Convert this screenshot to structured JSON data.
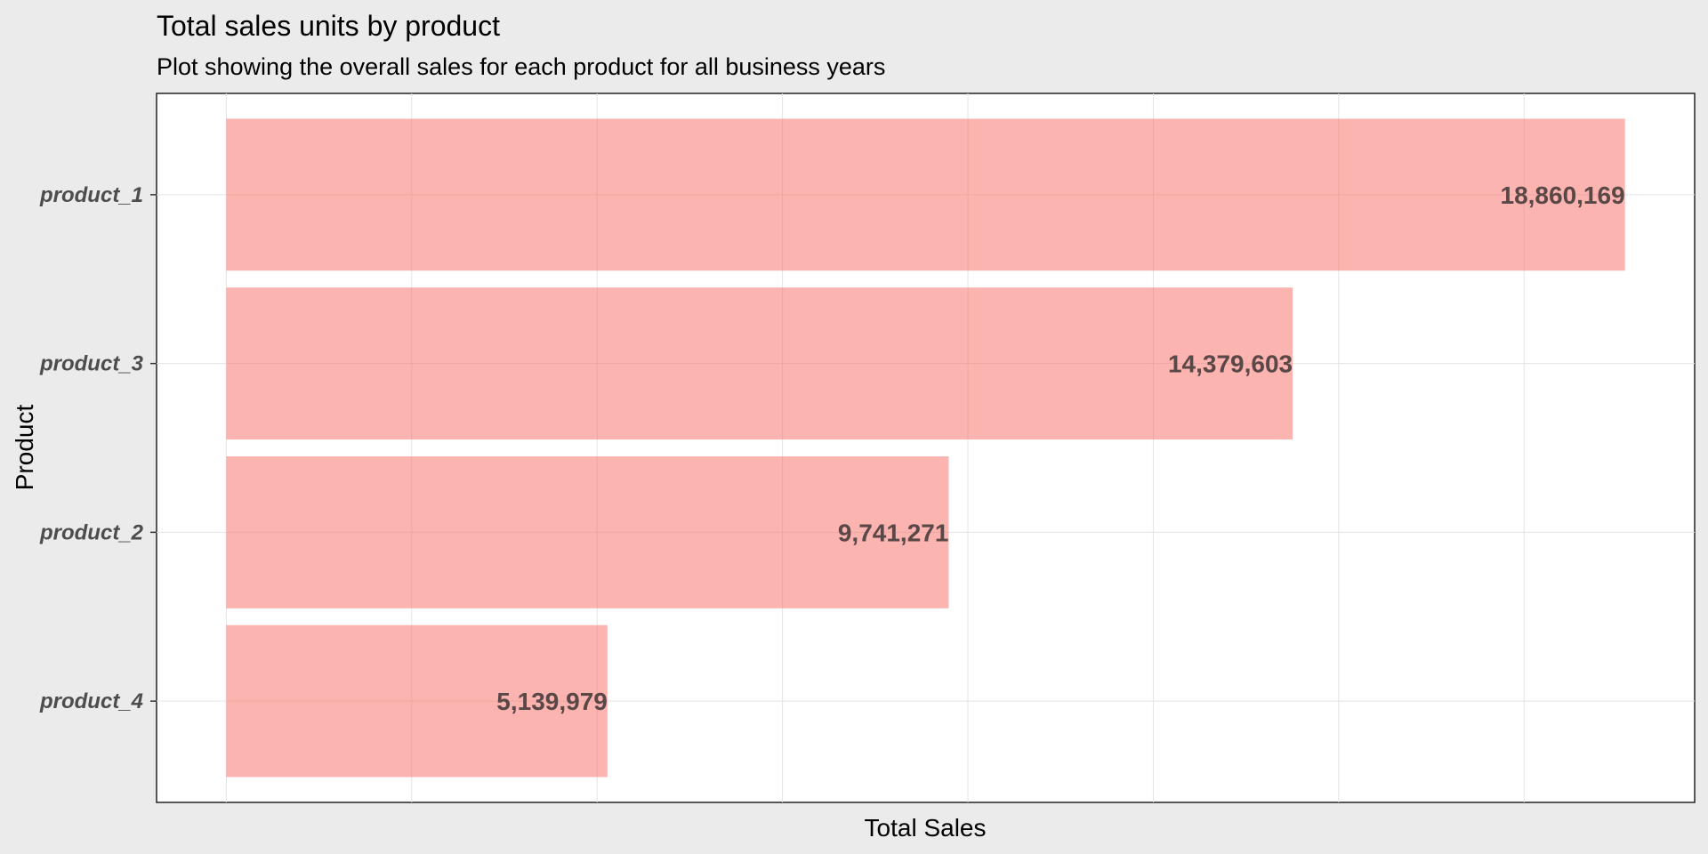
{
  "chart_data": {
    "type": "bar",
    "orientation": "horizontal",
    "title": "Total sales units by product",
    "subtitle": "Plot showing the overall sales for each product for all business years",
    "xlabel": "Total Sales",
    "ylabel": "Product",
    "categories": [
      "product_1",
      "product_3",
      "product_2",
      "product_4"
    ],
    "values": [
      18860169,
      14379603,
      9741271,
      5139979
    ],
    "value_labels": [
      "18,860,169",
      "14,379,603",
      "9,741,271",
      "5,139,979"
    ],
    "xlim": [
      -940000,
      19800000
    ],
    "grid": true,
    "legend": "none",
    "colors": {
      "bar": "#f8766d",
      "bar_opacity": 0.55,
      "panel_bg": "#ffffff",
      "plot_bg": "#ebebeb",
      "grid": "#e3e3e3",
      "label_text": "#5a4747"
    }
  }
}
